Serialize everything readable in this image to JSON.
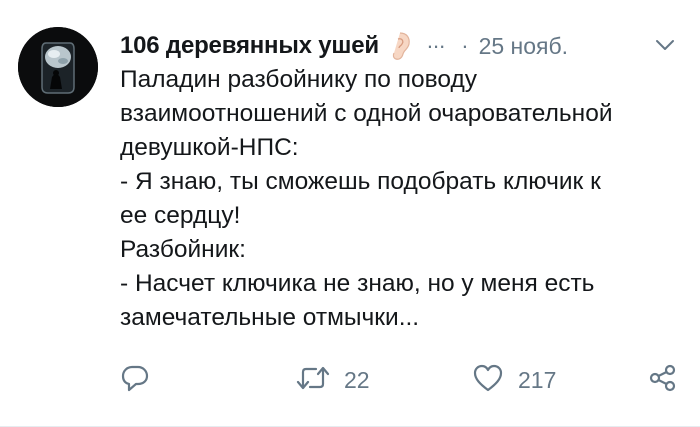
{
  "tweet": {
    "author_name": "106 деревянных ушей",
    "author_emoji": "ear-icon",
    "handle_ellipsis": "...",
    "separator": "·",
    "date": "25 нояб.",
    "lines": [
      "Паладин разбойнику по поводу",
      "взаимоотношений с одной очаровательной",
      "девушкой-НПС:",
      "- Я знаю, ты сможешь подобрать ключик к",
      "ее сердцу!",
      "Разбойник:",
      "- Насчет ключика не знаю, но у меня есть",
      "замечательные отмычки..."
    ]
  },
  "actions": {
    "reply": {
      "icon": "reply-icon"
    },
    "retweet": {
      "icon": "retweet-icon",
      "count": "22"
    },
    "like": {
      "icon": "heart-icon",
      "count": "217"
    },
    "share": {
      "icon": "share-icon"
    }
  },
  "colors": {
    "text": "#14171a",
    "secondary": "#657786",
    "divider": "#e6ecf0"
  }
}
